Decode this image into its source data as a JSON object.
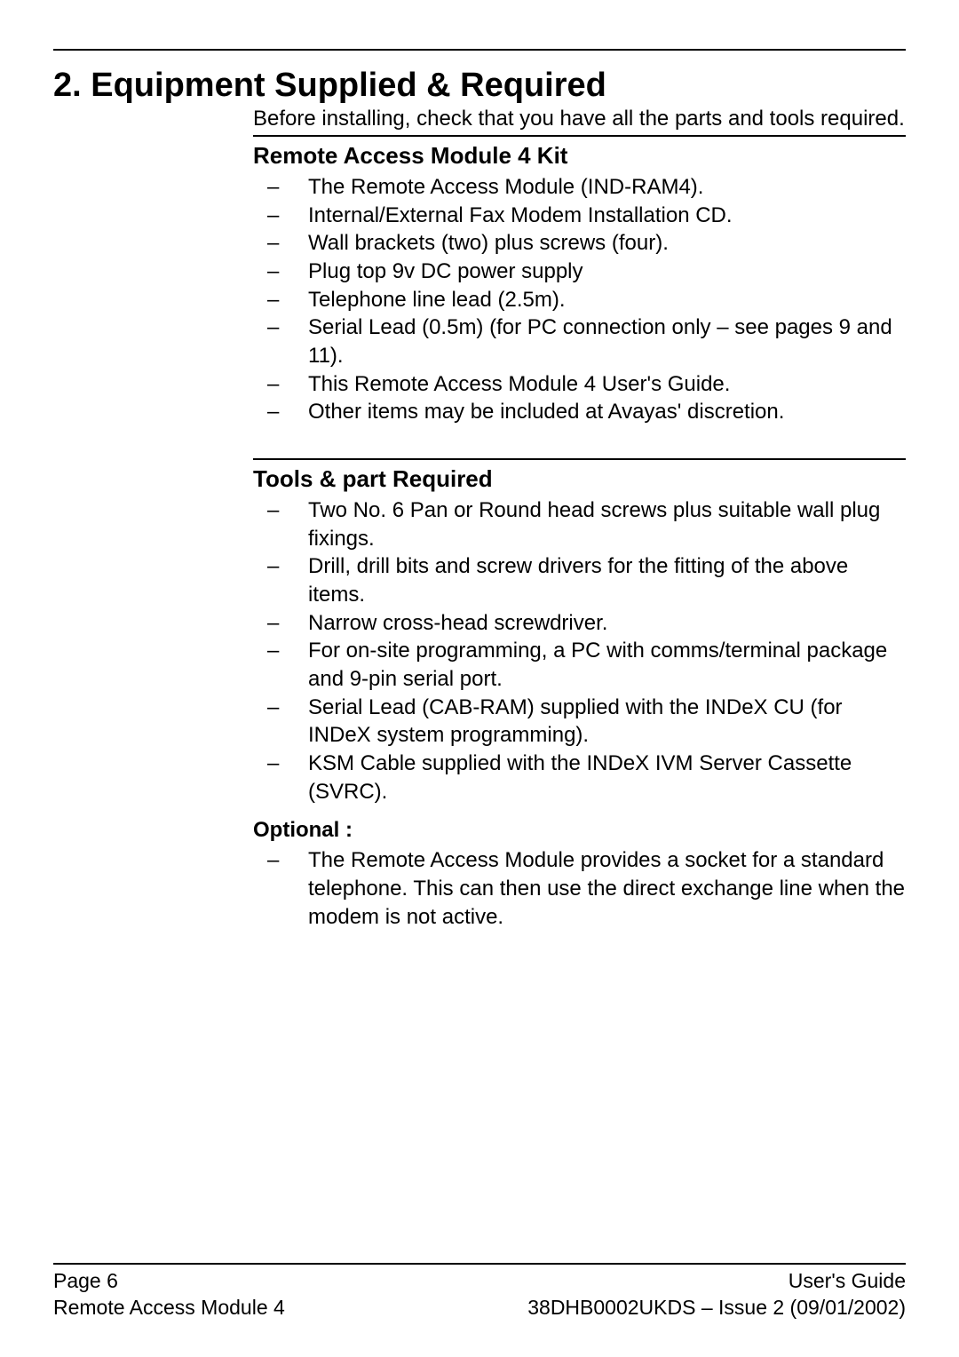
{
  "heading": "2. Equipment Supplied & Required",
  "intro": "Before installing, check that you have all the parts and tools required.",
  "section1": {
    "title": "Remote Access Module 4 Kit",
    "items": [
      "The Remote Access Module (IND-RAM4).",
      "Internal/External Fax Modem Installation CD.",
      "Wall brackets (two) plus screws (four).",
      "Plug top 9v DC power supply",
      "Telephone line lead (2.5m).",
      "Serial Lead (0.5m) (for PC connection only – see pages 9 and 11).",
      "This Remote Access Module 4 User's Guide.",
      "Other items may be included at Avayas' discretion."
    ]
  },
  "section2": {
    "title": "Tools & part Required",
    "items": [
      "Two No. 6 Pan or Round head screws plus suitable wall plug fixings.",
      "Drill, drill bits and screw drivers for the fitting of the above items.",
      "Narrow cross-head screwdriver.",
      "For on-site programming, a PC with comms/terminal package and 9-pin serial port.",
      "Serial Lead (CAB-RAM) supplied with the INDeX CU (for INDeX system programming).",
      "KSM Cable supplied with the INDeX IVM Server Cassette (SVRC)."
    ]
  },
  "section3": {
    "title": "Optional :",
    "items": [
      "The Remote Access Module provides a socket for a standard telephone. This can then use the direct exchange line when the modem is not active."
    ]
  },
  "footer": {
    "left1": "Page 6",
    "left2": "Remote Access Module 4",
    "right1": "User's Guide",
    "right2": "38DHB0002UKDS – Issue 2 (09/01/2002)"
  }
}
